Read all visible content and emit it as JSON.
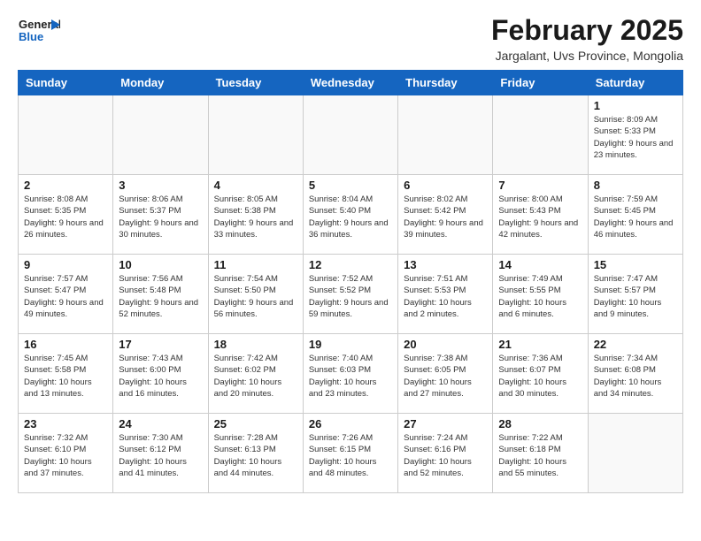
{
  "header": {
    "logo_general": "General",
    "logo_blue": "Blue",
    "month_year": "February 2025",
    "location": "Jargalant, Uvs Province, Mongolia"
  },
  "days_of_week": [
    "Sunday",
    "Monday",
    "Tuesday",
    "Wednesday",
    "Thursday",
    "Friday",
    "Saturday"
  ],
  "weeks": [
    [
      {
        "day": "",
        "info": ""
      },
      {
        "day": "",
        "info": ""
      },
      {
        "day": "",
        "info": ""
      },
      {
        "day": "",
        "info": ""
      },
      {
        "day": "",
        "info": ""
      },
      {
        "day": "",
        "info": ""
      },
      {
        "day": "1",
        "info": "Sunrise: 8:09 AM\nSunset: 5:33 PM\nDaylight: 9 hours and 23 minutes."
      }
    ],
    [
      {
        "day": "2",
        "info": "Sunrise: 8:08 AM\nSunset: 5:35 PM\nDaylight: 9 hours and 26 minutes."
      },
      {
        "day": "3",
        "info": "Sunrise: 8:06 AM\nSunset: 5:37 PM\nDaylight: 9 hours and 30 minutes."
      },
      {
        "day": "4",
        "info": "Sunrise: 8:05 AM\nSunset: 5:38 PM\nDaylight: 9 hours and 33 minutes."
      },
      {
        "day": "5",
        "info": "Sunrise: 8:04 AM\nSunset: 5:40 PM\nDaylight: 9 hours and 36 minutes."
      },
      {
        "day": "6",
        "info": "Sunrise: 8:02 AM\nSunset: 5:42 PM\nDaylight: 9 hours and 39 minutes."
      },
      {
        "day": "7",
        "info": "Sunrise: 8:00 AM\nSunset: 5:43 PM\nDaylight: 9 hours and 42 minutes."
      },
      {
        "day": "8",
        "info": "Sunrise: 7:59 AM\nSunset: 5:45 PM\nDaylight: 9 hours and 46 minutes."
      }
    ],
    [
      {
        "day": "9",
        "info": "Sunrise: 7:57 AM\nSunset: 5:47 PM\nDaylight: 9 hours and 49 minutes."
      },
      {
        "day": "10",
        "info": "Sunrise: 7:56 AM\nSunset: 5:48 PM\nDaylight: 9 hours and 52 minutes."
      },
      {
        "day": "11",
        "info": "Sunrise: 7:54 AM\nSunset: 5:50 PM\nDaylight: 9 hours and 56 minutes."
      },
      {
        "day": "12",
        "info": "Sunrise: 7:52 AM\nSunset: 5:52 PM\nDaylight: 9 hours and 59 minutes."
      },
      {
        "day": "13",
        "info": "Sunrise: 7:51 AM\nSunset: 5:53 PM\nDaylight: 10 hours and 2 minutes."
      },
      {
        "day": "14",
        "info": "Sunrise: 7:49 AM\nSunset: 5:55 PM\nDaylight: 10 hours and 6 minutes."
      },
      {
        "day": "15",
        "info": "Sunrise: 7:47 AM\nSunset: 5:57 PM\nDaylight: 10 hours and 9 minutes."
      }
    ],
    [
      {
        "day": "16",
        "info": "Sunrise: 7:45 AM\nSunset: 5:58 PM\nDaylight: 10 hours and 13 minutes."
      },
      {
        "day": "17",
        "info": "Sunrise: 7:43 AM\nSunset: 6:00 PM\nDaylight: 10 hours and 16 minutes."
      },
      {
        "day": "18",
        "info": "Sunrise: 7:42 AM\nSunset: 6:02 PM\nDaylight: 10 hours and 20 minutes."
      },
      {
        "day": "19",
        "info": "Sunrise: 7:40 AM\nSunset: 6:03 PM\nDaylight: 10 hours and 23 minutes."
      },
      {
        "day": "20",
        "info": "Sunrise: 7:38 AM\nSunset: 6:05 PM\nDaylight: 10 hours and 27 minutes."
      },
      {
        "day": "21",
        "info": "Sunrise: 7:36 AM\nSunset: 6:07 PM\nDaylight: 10 hours and 30 minutes."
      },
      {
        "day": "22",
        "info": "Sunrise: 7:34 AM\nSunset: 6:08 PM\nDaylight: 10 hours and 34 minutes."
      }
    ],
    [
      {
        "day": "23",
        "info": "Sunrise: 7:32 AM\nSunset: 6:10 PM\nDaylight: 10 hours and 37 minutes."
      },
      {
        "day": "24",
        "info": "Sunrise: 7:30 AM\nSunset: 6:12 PM\nDaylight: 10 hours and 41 minutes."
      },
      {
        "day": "25",
        "info": "Sunrise: 7:28 AM\nSunset: 6:13 PM\nDaylight: 10 hours and 44 minutes."
      },
      {
        "day": "26",
        "info": "Sunrise: 7:26 AM\nSunset: 6:15 PM\nDaylight: 10 hours and 48 minutes."
      },
      {
        "day": "27",
        "info": "Sunrise: 7:24 AM\nSunset: 6:16 PM\nDaylight: 10 hours and 52 minutes."
      },
      {
        "day": "28",
        "info": "Sunrise: 7:22 AM\nSunset: 6:18 PM\nDaylight: 10 hours and 55 minutes."
      },
      {
        "day": "",
        "info": ""
      }
    ]
  ]
}
